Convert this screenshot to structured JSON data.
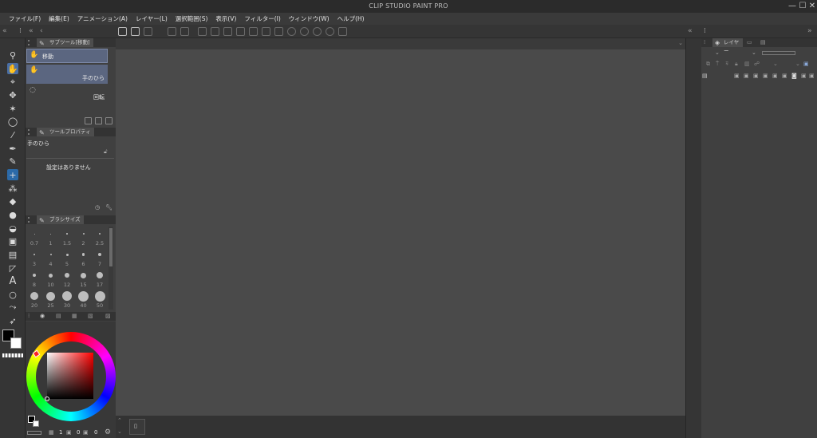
{
  "app": {
    "title": "CLIP STUDIO PAINT PRO"
  },
  "menu": [
    "ファイル(F)",
    "編集(E)",
    "アニメーション(A)",
    "レイヤー(L)",
    "選択範囲(S)",
    "表示(V)",
    "フィルター(I)",
    "ウィンドウ(W)",
    "ヘルプ(H)"
  ],
  "window_controls": {
    "minimize": "—",
    "maximize": "☐",
    "close": "✕"
  },
  "subtool_panel": {
    "tab": "サブツール[移動]",
    "items": [
      {
        "label": "移動",
        "icon": "hand-icon"
      },
      {
        "label": "手のひら",
        "icon": "hand-icon"
      },
      {
        "label": "回転",
        "icon": "rotate-icon"
      }
    ]
  },
  "tool_property": {
    "tab": "ツールプロパティ",
    "current": "手のひら",
    "empty_message": "設定はありません"
  },
  "brush_size": {
    "tab": "ブラシサイズ",
    "sizes": [
      "0.7",
      "1",
      "1.5",
      "2",
      "2.5",
      "3",
      "4",
      "5",
      "6",
      "7",
      "8",
      "10",
      "12",
      "15",
      "17",
      "20",
      "25",
      "30",
      "40",
      "50"
    ]
  },
  "layer_panel": {
    "tab": "レイヤー"
  },
  "status": {
    "value_a": "1",
    "value_b": "0",
    "value_c": "0"
  },
  "colors": {
    "main": "#000000",
    "sub": "#ffffff",
    "accent": "#5b6680"
  }
}
